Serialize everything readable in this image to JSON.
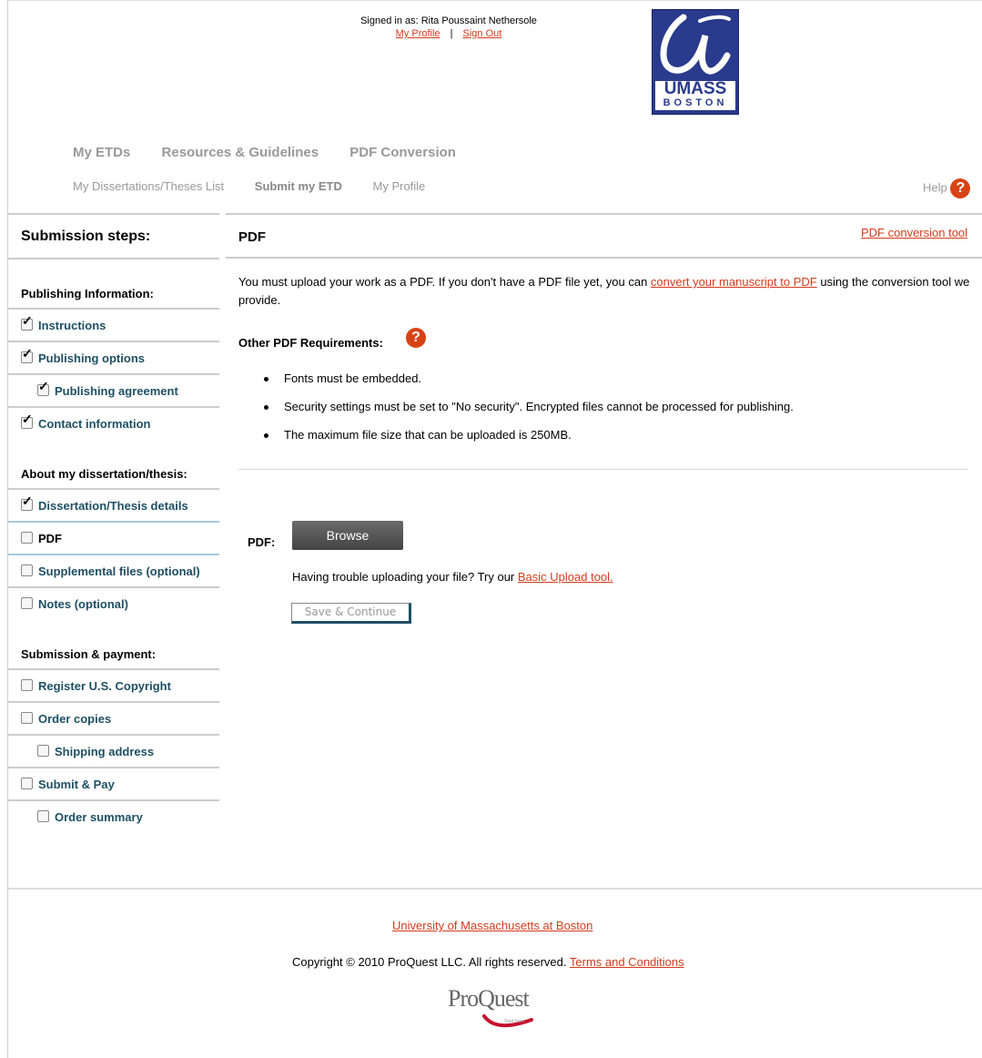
{
  "header": {
    "signed_in": "Signed in as: Rita Poussaint Nethersole",
    "my_profile": "My Profile",
    "sign_out": "Sign Out",
    "logo_line1": "UMASS",
    "logo_line2": "BOSTON"
  },
  "nav_primary": [
    "My ETDs",
    "Resources & Guidelines",
    "PDF Conversion"
  ],
  "nav_secondary": {
    "list": "My Dissertations/Theses List",
    "submit": "Submit my ETD",
    "profile": "My Profile",
    "help": "Help"
  },
  "sidebar": {
    "title": "Submission steps:",
    "section1": "Publishing Information:",
    "instructions": "Instructions",
    "publishing_options": "Publishing options",
    "publishing_agreement": "Publishing agreement",
    "contact": "Contact information",
    "section2": "About my dissertation/thesis:",
    "details": "Dissertation/Thesis details",
    "pdf": "PDF",
    "supplemental": "Supplemental files (optional)",
    "notes": "Notes (optional)",
    "section3": "Submission & payment:",
    "copyright": "Register U.S. Copyright",
    "order_copies": "Order copies",
    "shipping": "Shipping address",
    "submit_pay": "Submit & Pay",
    "order_summary": "Order summary"
  },
  "main": {
    "title": "PDF",
    "pdf_tool_link": "PDF conversion tool",
    "intro_before": "You must upload your work as a PDF. If you don't have a PDF file yet, you can ",
    "intro_link": "convert your manuscript to PDF",
    "intro_after": " using the conversion tool we provide.",
    "requirements_heading": "Other PDF Requirements:",
    "requirements": [
      "Fonts must be embedded.",
      "Security settings must be set to \"No security\". Encrypted files cannot be processed for publishing.",
      "The maximum file size that can be uploaded is 250MB."
    ],
    "pdf_label": "PDF:",
    "browse": "Browse",
    "trouble_text": "Having trouble uploading your file? Try our ",
    "basic_upload": "Basic Upload tool.",
    "save_continue": "Save & Continue"
  },
  "footer": {
    "university": "University of Massachusetts at Boston",
    "copyright": "Copyright © 2010 ProQuest LLC. All rights reserved.",
    "terms": "Terms and Conditions",
    "proquest": "ProQuest",
    "tagline": "Start here."
  },
  "colors": {
    "link": "#d33b1c",
    "nav_item": "#1e4f63",
    "help_icon": "#d84315",
    "logo": "#2a3a8c"
  },
  "icons": [
    "question-icon",
    "checkbox-checked-icon",
    "checkbox-empty-icon"
  ]
}
